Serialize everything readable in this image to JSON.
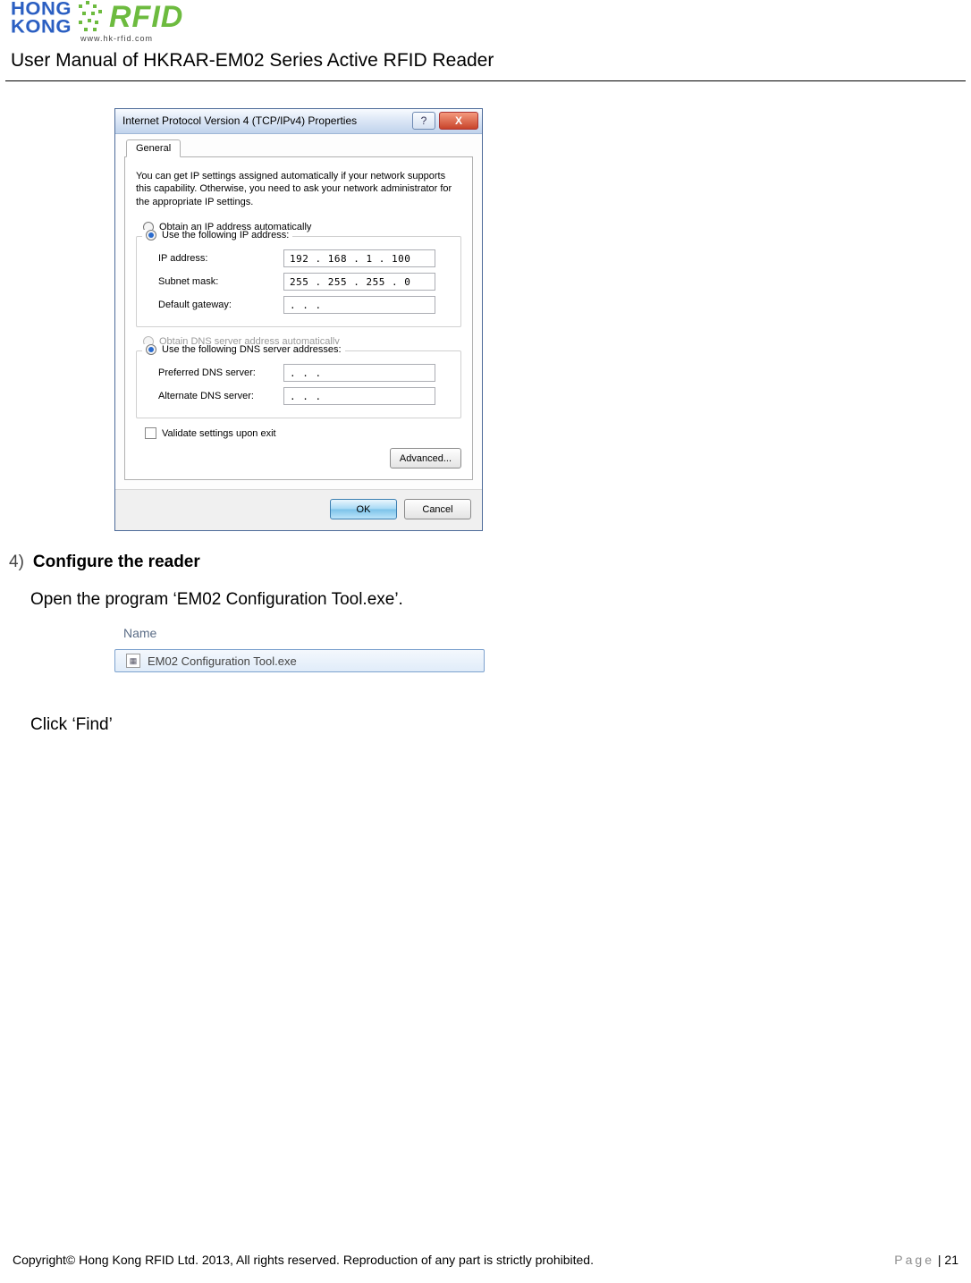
{
  "logo": {
    "line1": "HONG",
    "line2": "KONG",
    "rfid": "RFID",
    "url": "www.hk-rfid.com"
  },
  "doc_title": "User Manual of HKRAR-EM02 Series Active RFID Reader",
  "dialog": {
    "title": "Internet Protocol Version 4 (TCP/IPv4) Properties",
    "help_icon": "?",
    "close_icon": "X",
    "tab_general": "General",
    "desc": "You can get IP settings assigned automatically if your network supports this capability. Otherwise, you need to ask your network administrator for the appropriate IP settings.",
    "radio_obtain_ip": "Obtain an IP address automatically",
    "radio_use_ip": "Use the following IP address:",
    "lbl_ip": "IP address:",
    "val_ip": "192 . 168 .   1   . 100",
    "lbl_subnet": "Subnet mask:",
    "val_subnet": "255 . 255 . 255 .   0",
    "lbl_gateway": "Default gateway:",
    "val_gateway": ".       .       .",
    "radio_obtain_dns": "Obtain DNS server address automatically",
    "radio_use_dns": "Use the following DNS server addresses:",
    "lbl_pref_dns": "Preferred DNS server:",
    "val_pref_dns": ".       .       .",
    "lbl_alt_dns": "Alternate DNS server:",
    "val_alt_dns": ".       .       .",
    "chk_validate": "Validate settings upon exit",
    "btn_advanced": "Advanced...",
    "btn_ok": "OK",
    "btn_cancel": "Cancel"
  },
  "step": {
    "num": "4)",
    "title": "Configure the reader",
    "text1": "Open the program ‘EM02 Configuration Tool.exe’.",
    "text2": "Click ‘Find’"
  },
  "explorer": {
    "header": "Name",
    "filename": "EM02 Configuration Tool.exe"
  },
  "footer": {
    "copyright": "Copyright© Hong Kong RFID Ltd. 2013, All rights reserved. Reproduction of any part is strictly prohibited.",
    "page_label": "Page",
    "page_sep": " | ",
    "page_num": "21"
  }
}
